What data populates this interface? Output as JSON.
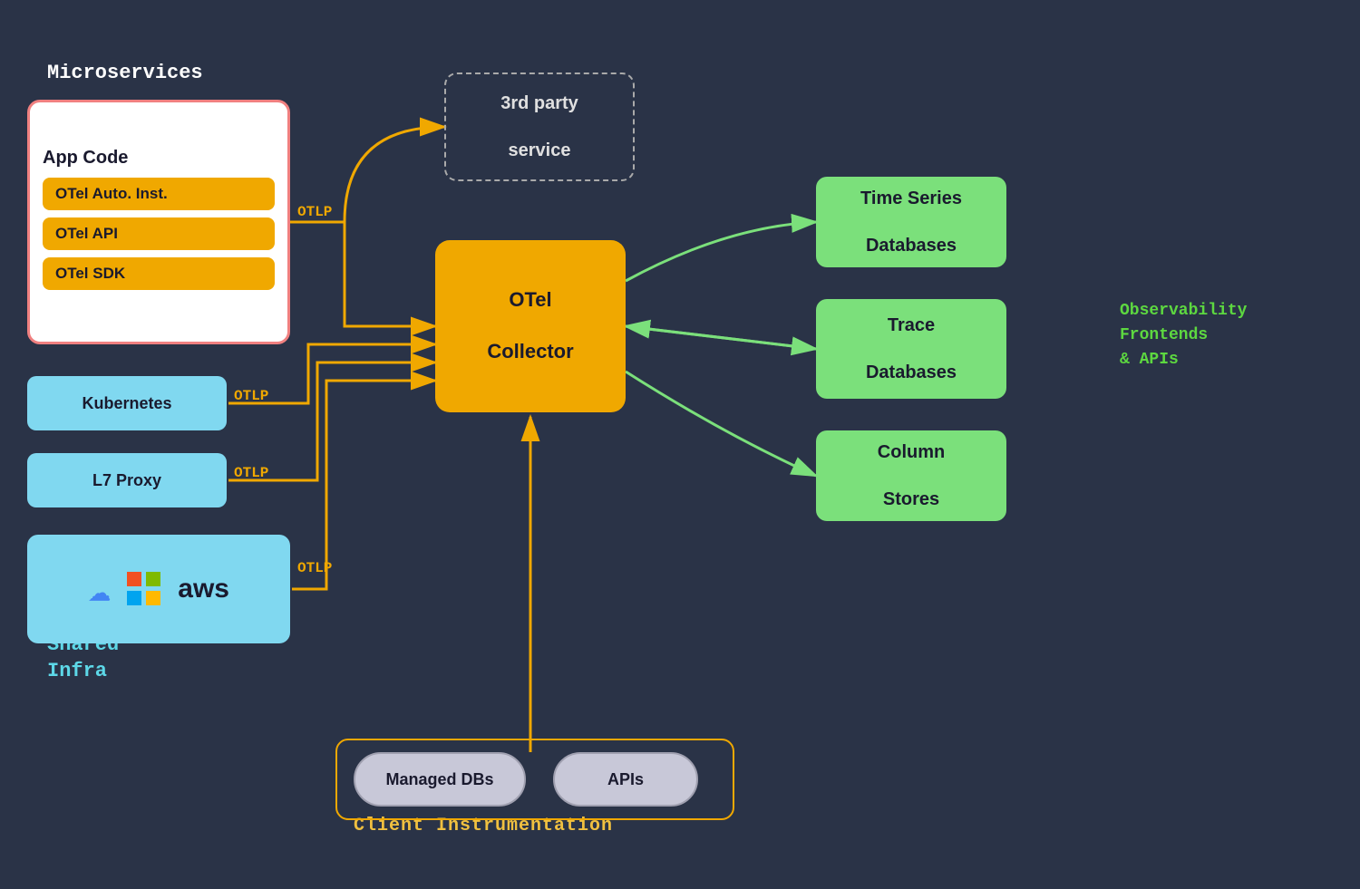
{
  "background": "#2a3347",
  "labels": {
    "microservices": "Microservices",
    "shared_infra_line1": "Shared",
    "shared_infra_line2": "Infra",
    "client_instrumentation": "Client Instrumentation",
    "observability_line1": "Observability",
    "observability_line2": "Frontends",
    "observability_line3": "& APIs"
  },
  "boxes": {
    "appcode_title": "App Code",
    "otel_auto": "OTel Auto. Inst.",
    "otel_api": "OTel API",
    "otel_sdk": "OTel SDK",
    "kubernetes": "Kubernetes",
    "l7proxy": "L7 Proxy",
    "third_party_line1": "3rd party",
    "third_party_line2": "service",
    "collector_line1": "OTel",
    "collector_line2": "Collector",
    "time_series_line1": "Time Series",
    "time_series_line2": "Databases",
    "trace_line1": "Trace",
    "trace_line2": "Databases",
    "column_line1": "Column",
    "column_line2": "Stores",
    "managed_dbs": "Managed DBs",
    "apis": "APIs"
  },
  "otlp_labels": {
    "otlp1": "OTLP",
    "otlp2": "OTLP",
    "otlp3": "OTLP",
    "otlp4": "OTLP"
  }
}
